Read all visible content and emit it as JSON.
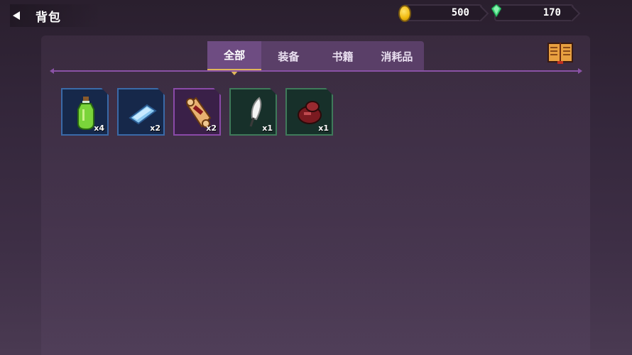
{
  "header": {
    "title": "背包",
    "back_icon": "back-arrow-icon"
  },
  "currency": [
    {
      "name": "gold",
      "icon": "coin-icon",
      "value": "500",
      "color": "#f0b90e"
    },
    {
      "name": "gem",
      "icon": "gem-icon",
      "value": "170",
      "color": "#3ed47a"
    }
  ],
  "tabs": [
    {
      "label": "全部",
      "active": true
    },
    {
      "label": "装备",
      "active": false
    },
    {
      "label": "书籍",
      "active": false
    },
    {
      "label": "消耗品",
      "active": false
    }
  ],
  "book_icon": "book-icon",
  "items": [
    {
      "icon": "potion-icon",
      "qty": "x4",
      "rarity": "blue"
    },
    {
      "icon": "ice-bar-icon",
      "qty": "x2",
      "rarity": "blue"
    },
    {
      "icon": "scroll-icon",
      "qty": "x2",
      "rarity": "purple"
    },
    {
      "icon": "feather-icon",
      "qty": "x1",
      "rarity": "green"
    },
    {
      "icon": "meat-icon",
      "qty": "x1",
      "rarity": "green"
    }
  ]
}
